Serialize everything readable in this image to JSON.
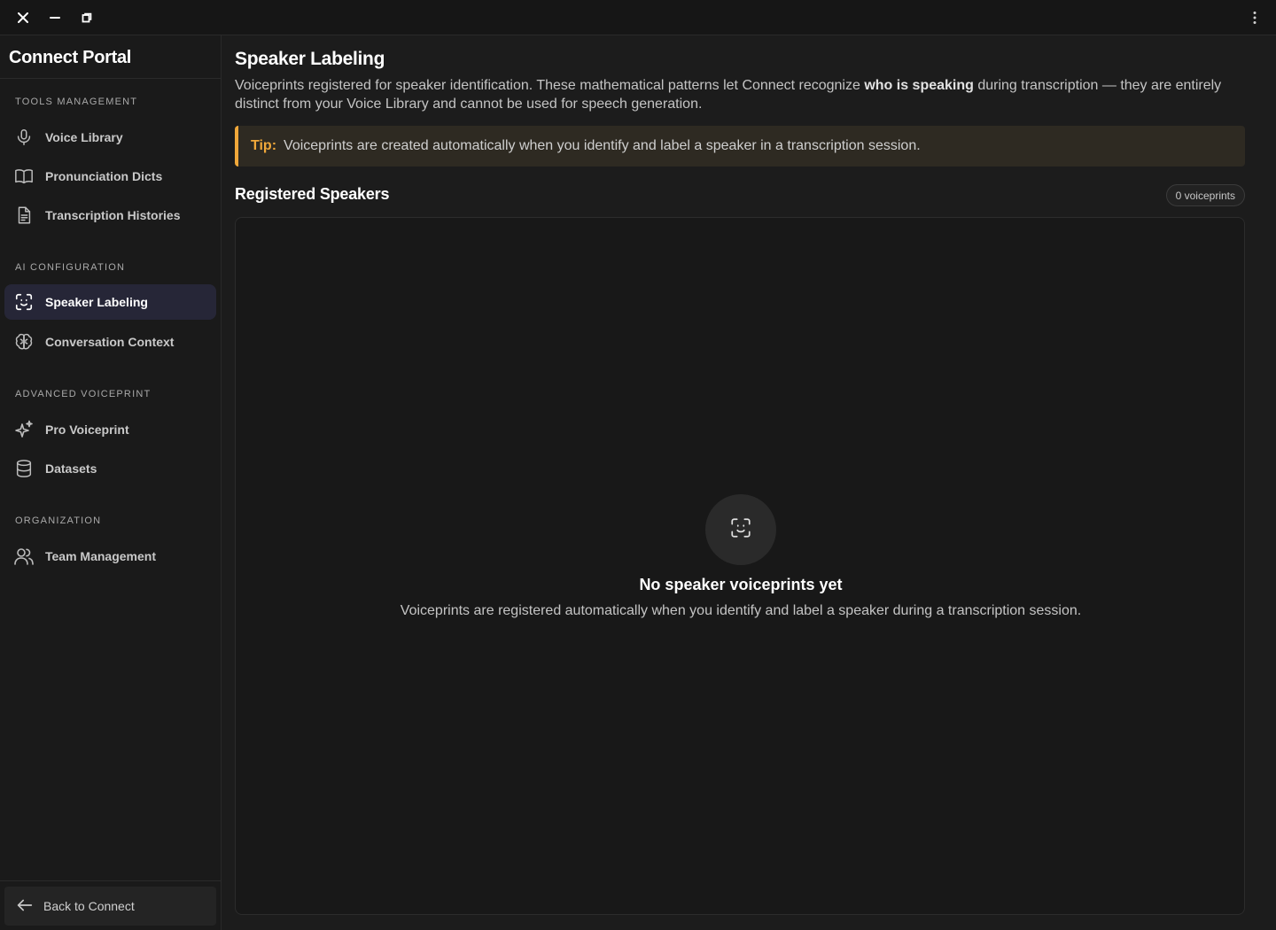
{
  "window": {
    "controls": [
      "close-icon",
      "minimize-icon",
      "restore-icon"
    ],
    "menu_icon": "more-vertical-icon"
  },
  "sidebar": {
    "brand": "Connect Portal",
    "sections": [
      {
        "label": "TOOLS MANAGEMENT",
        "items": [
          {
            "label": "Voice Library",
            "icon": "microphone-icon",
            "active": false
          },
          {
            "label": "Pronunciation Dicts",
            "icon": "book-icon",
            "active": false
          },
          {
            "label": "Transcription Histories",
            "icon": "document-icon",
            "active": false
          }
        ]
      },
      {
        "label": "AI CONFIGURATION",
        "items": [
          {
            "label": "Speaker Labeling",
            "icon": "face-scan-icon",
            "active": true
          },
          {
            "label": "Conversation Context",
            "icon": "brain-icon",
            "active": false
          }
        ]
      },
      {
        "label": "ADVANCED VOICEPRINT",
        "items": [
          {
            "label": "Pro Voiceprint",
            "icon": "sparkles-icon",
            "active": false
          },
          {
            "label": "Datasets",
            "icon": "database-icon",
            "active": false
          }
        ]
      },
      {
        "label": "ORGANIZATION",
        "items": [
          {
            "label": "Team Management",
            "icon": "users-icon",
            "active": false
          }
        ]
      }
    ],
    "back_label": "Back to Connect"
  },
  "main": {
    "title": "Speaker Labeling",
    "description_before": "Voiceprints registered for speaker identification. These mathematical patterns let Connect recognize ",
    "description_bold": "who is speaking",
    "description_after": " during transcription — they are entirely distinct from your Voice Library and cannot be used for speech generation.",
    "tip_label": "Tip:",
    "tip_text": "Voiceprints are created automatically when you identify and label a speaker in a transcription session.",
    "section_title": "Registered Speakers",
    "count_badge": "0 voiceprints",
    "empty_title": "No speaker voiceprints yet",
    "empty_desc": "Voiceprints are registered automatically when you identify and label a speaker during a transcription session."
  },
  "colors": {
    "background": "#1c1c1c",
    "sidebar": "#1a1a1a",
    "active_item": "#262637",
    "tip_accent": "#f0a83a",
    "tip_background": "#2e2a22"
  }
}
